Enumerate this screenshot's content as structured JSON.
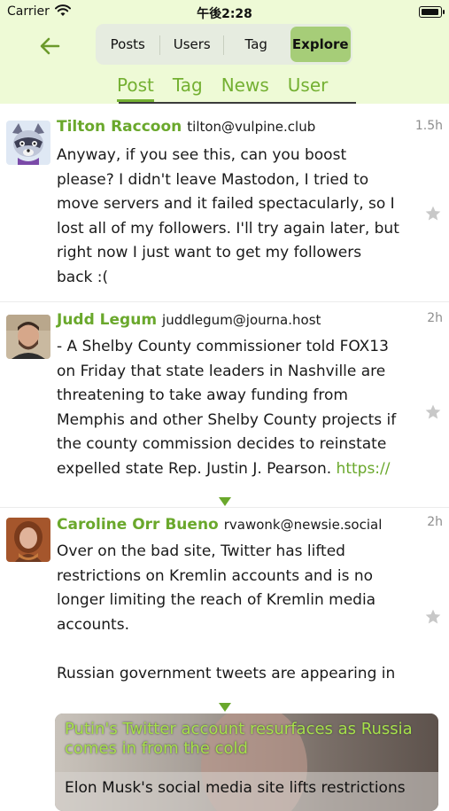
{
  "status_bar": {
    "carrier": "Carrier",
    "time": "午後2:28"
  },
  "nav": {
    "segments": [
      "Posts",
      "Users",
      "Tag",
      "Explore"
    ],
    "active_segment": "Explore",
    "subtabs": [
      "Post",
      "Tag",
      "News",
      "User"
    ],
    "active_subtab": "Post"
  },
  "posts": [
    {
      "name": "Tilton Raccoon",
      "handle": "tilton@vulpine.club",
      "time": "1.5h",
      "lines": [
        "Anyway, if you see this, can you boost",
        "please? I didn't leave Mastodon, I tried to",
        "move servers and it failed spectacularly, so I",
        "lost all of my followers. I'll try again later, but",
        "right now I just want to get my followers",
        "back :("
      ]
    },
    {
      "name": "Judd Legum",
      "handle": "juddlegum@journa.host",
      "time": "2h",
      "lines": [
        "- A Shelby County commissioner told FOX13",
        "on Friday that state leaders in Nashville are",
        "threatening to take away funding from",
        "Memphis and other Shelby County projects if",
        "the county commission decides to reinstate",
        "expelled state Rep. Justin J. Pearson."
      ],
      "link": "https://"
    },
    {
      "name": "Caroline Orr Bueno",
      "handle": "rvawonk@newsie.social",
      "time": "2h",
      "lines": [
        "Over on the bad site, Twitter has lifted",
        "restrictions on Kremlin accounts and is no",
        "longer limiting the reach of Kremlin media",
        "accounts.",
        "",
        "Russian government tweets are appearing in"
      ],
      "card": {
        "title": "Putin's Twitter account resurfaces as Russia comes in from the cold",
        "description": "Elon Musk's social media site lifts restrictions"
      }
    }
  ],
  "colors": {
    "header_bg": "#eefad6",
    "accent_green": "#6aa82c",
    "active_segment": "#a6cd78"
  }
}
